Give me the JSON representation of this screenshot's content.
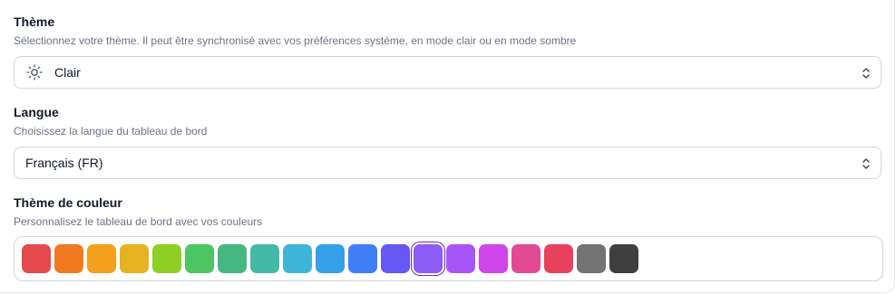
{
  "theme": {
    "title": "Thème",
    "description": "Sélectionnez votre thème. Il peut être synchronisé avec vos préférences système, en mode clair ou en mode sombre",
    "selected": "Clair",
    "icon": "sun-icon"
  },
  "language": {
    "title": "Langue",
    "description": "Choisissez la langue du tableau de bord",
    "selected": "Français (FR)"
  },
  "color_theme": {
    "title": "Thème de couleur",
    "description": "Personnalisez le tableau de bord avec vos couleurs",
    "selected_index": 12,
    "swatches": [
      "#e5484d",
      "#f1791f",
      "#f4a01c",
      "#e5b321",
      "#8fce24",
      "#4dc562",
      "#45b882",
      "#43b9a7",
      "#3eb4d9",
      "#35a0ea",
      "#3f7ff5",
      "#6558f5",
      "#8b5cf6",
      "#a855f7",
      "#d045e9",
      "#e24a94",
      "#e8415c",
      "#737373",
      "#3f3f3f"
    ]
  }
}
